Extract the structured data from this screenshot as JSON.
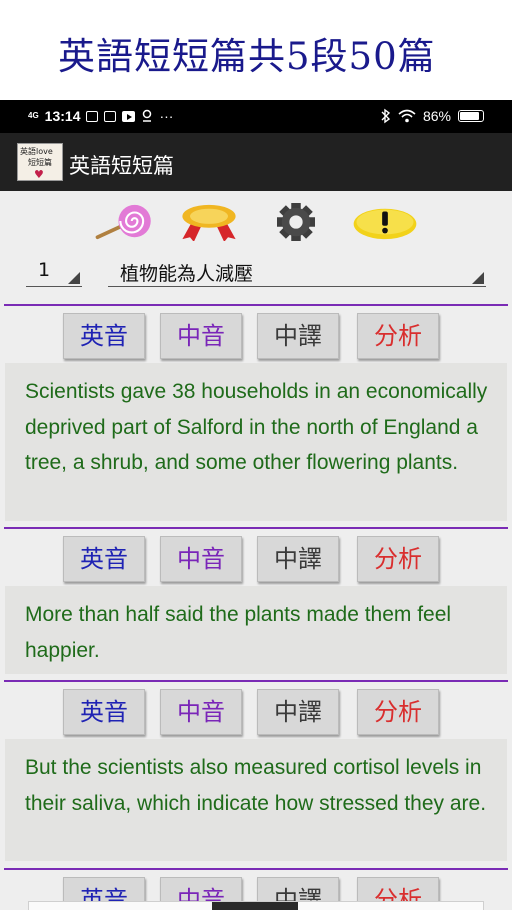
{
  "banner": {
    "title": "英語短短篇共5段50篇"
  },
  "status_bar": {
    "network": "4G",
    "time": "13:14",
    "more": "···",
    "battery": "86%"
  },
  "app_bar": {
    "title": "英語短短篇",
    "logo_text_top": "英語love",
    "logo_text_bottom": "短短篇"
  },
  "toolbar": {
    "icons": [
      "lollipop-icon",
      "award-ribbon-icon",
      "gear-icon",
      "warning-icon"
    ]
  },
  "selectors": {
    "number": "1",
    "article": "植物能為人減壓"
  },
  "buttons": {
    "en_audio": "英音",
    "zh_audio": "中音",
    "zh_translation": "中譯",
    "analysis": "分析"
  },
  "colors": {
    "en_audio": "#1f23b4",
    "zh_audio": "#7a25b8",
    "zh_translation": "#3a3a3a",
    "analysis": "#d92e2e",
    "paragraph_text": "#1f6b1a",
    "divider": "#7a2bb5"
  },
  "paragraphs": [
    {
      "text": "Scientists gave 38 households in an economically deprived part of Salford in the north of England a tree, a shrub, and some other flowering plants."
    },
    {
      "text": "More than half said the plants made them feel happier."
    },
    {
      "text": "But the scientists also measured cortisol levels in their saliva, which indicate how stressed they are."
    }
  ]
}
